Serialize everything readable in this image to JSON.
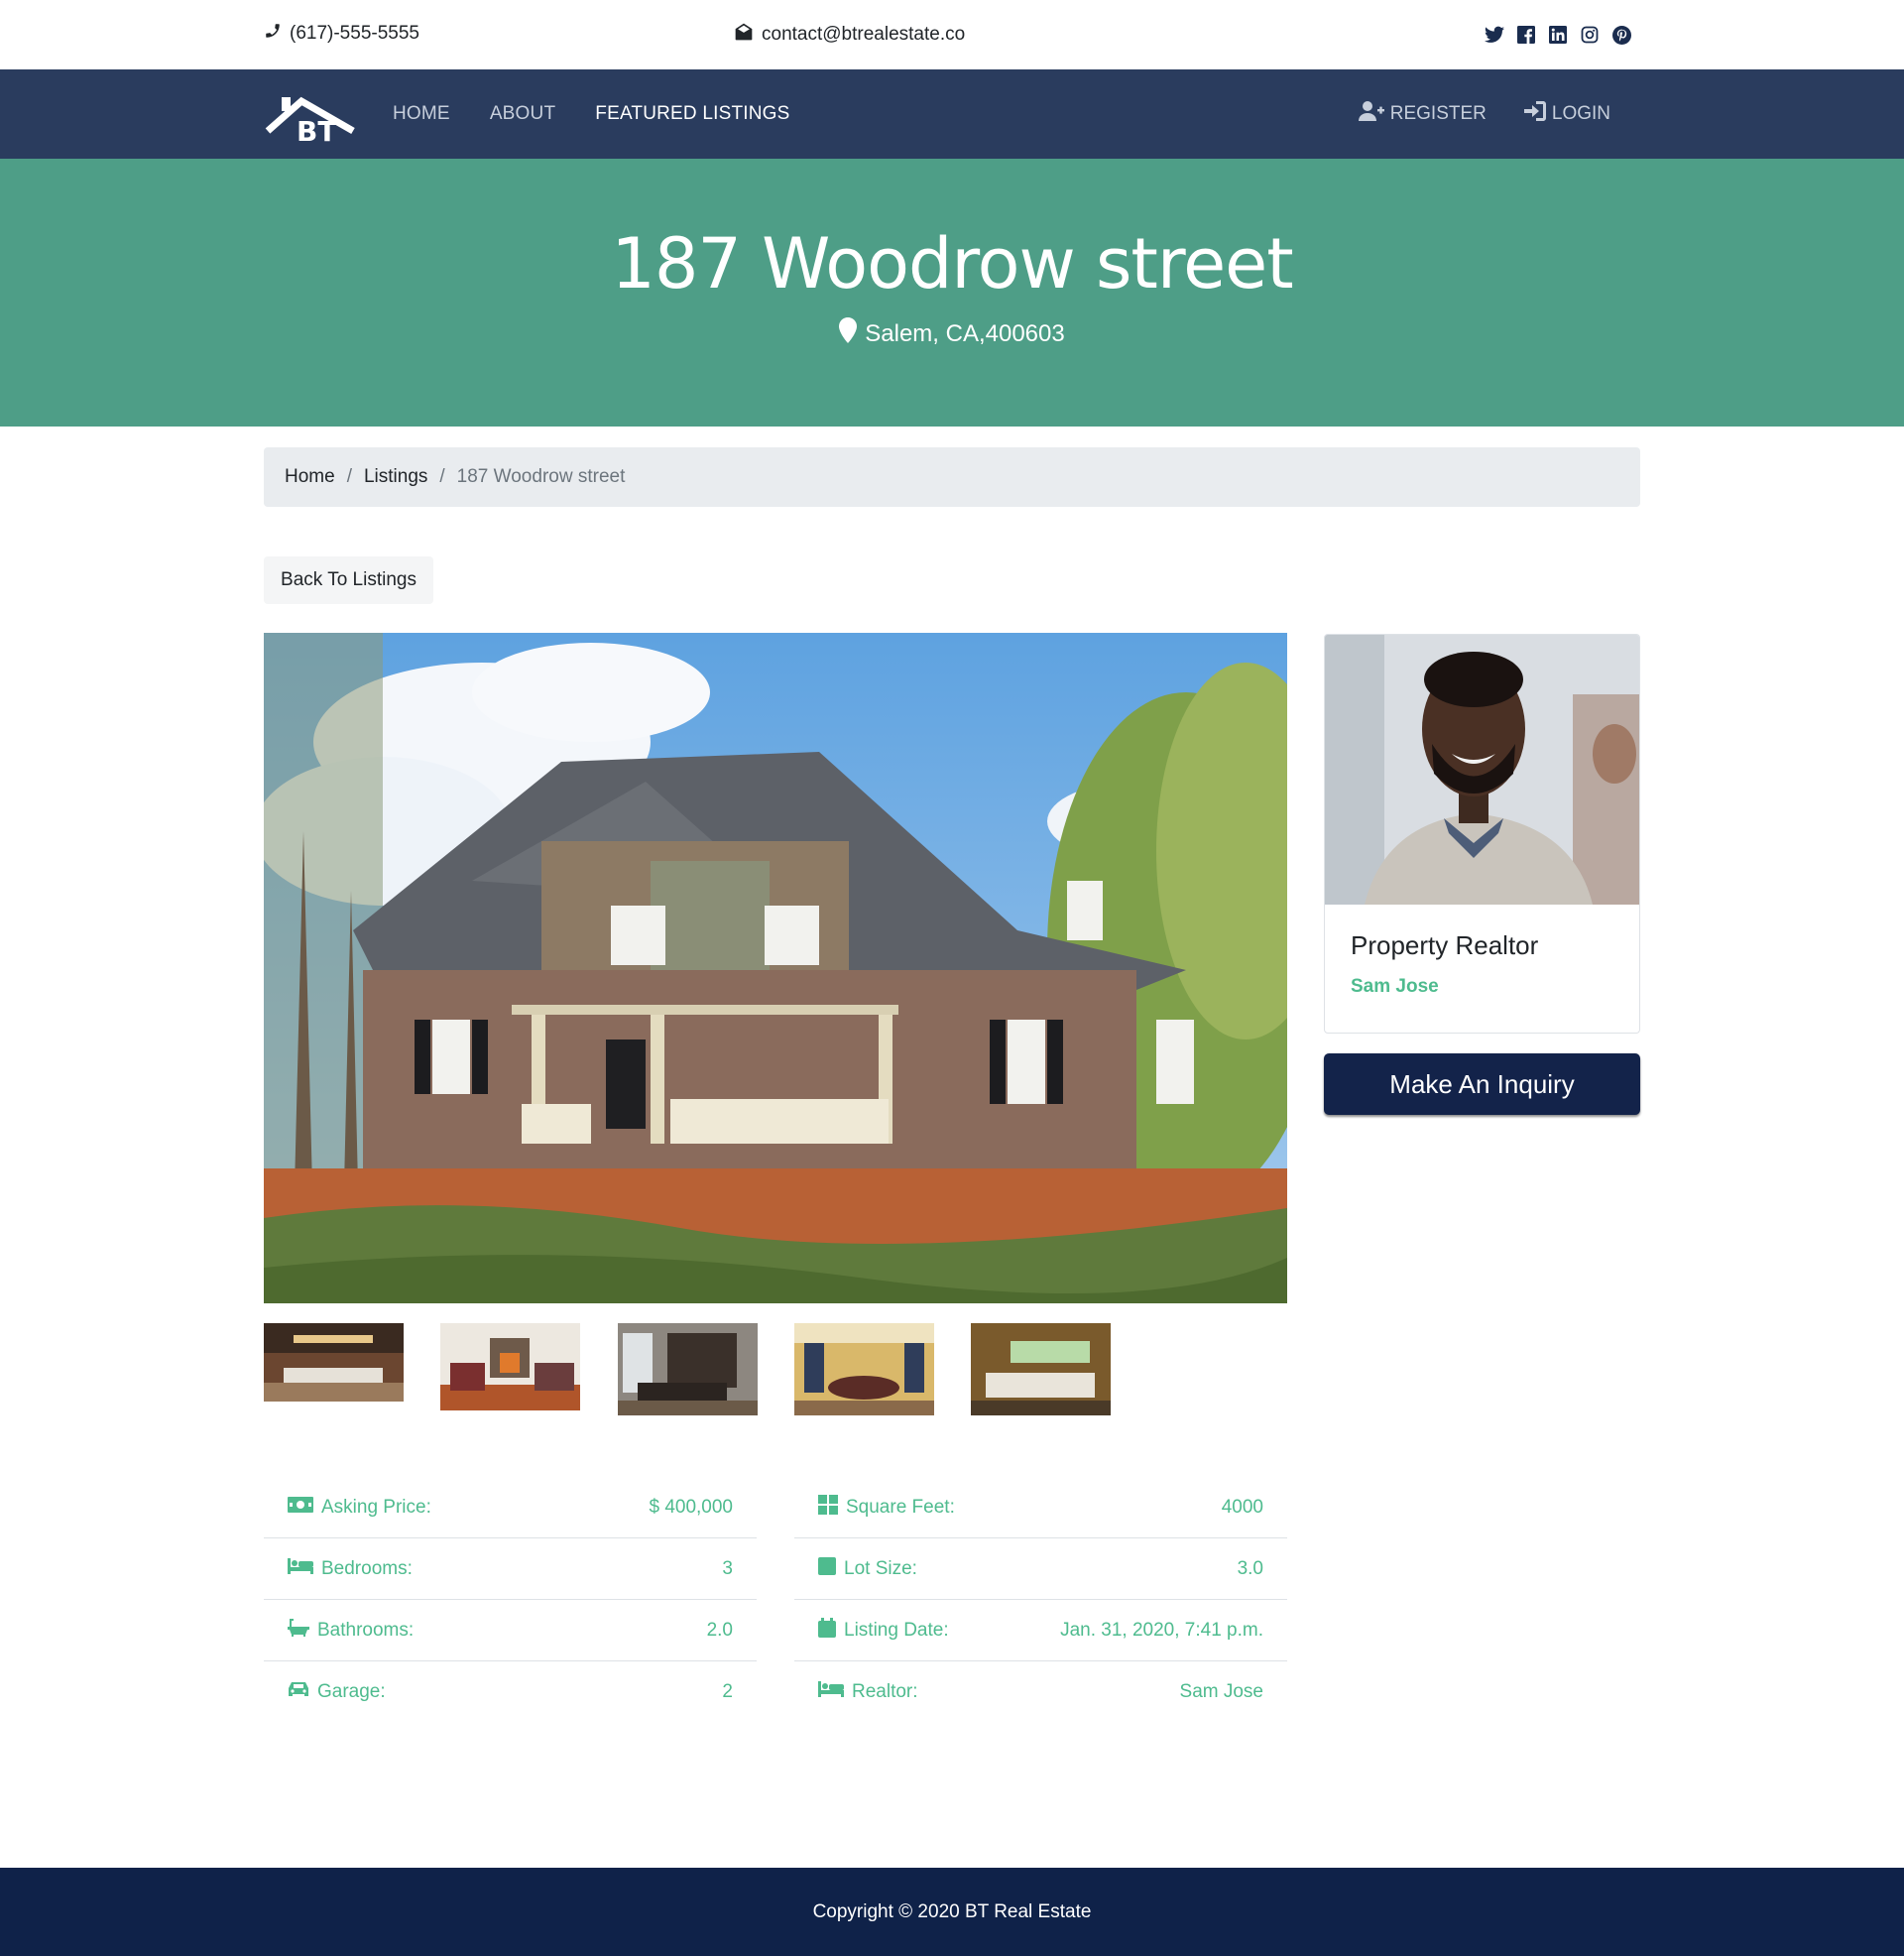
{
  "topbar": {
    "phone": "(617)-555-5555",
    "email": "contact@btrealestate.co",
    "social_icons": [
      "twitter-icon",
      "facebook-icon",
      "linkedin-icon",
      "instagram-icon",
      "pinterest-icon"
    ]
  },
  "navbar": {
    "logo_text": "BT",
    "links": [
      {
        "label": "HOME",
        "active": false
      },
      {
        "label": "ABOUT",
        "active": false
      },
      {
        "label": "FEATURED LISTINGS",
        "active": true
      }
    ],
    "register_label": "REGISTER",
    "login_label": "LOGIN"
  },
  "hero": {
    "title": "187 Woodrow street",
    "location": "Salem, CA,400603"
  },
  "breadcrumb": {
    "home": "Home",
    "listings": "Listings",
    "current": "187 Woodrow street"
  },
  "back_button": "Back To Listings",
  "realtor": {
    "title": "Property Realtor",
    "name": "Sam Jose"
  },
  "inquiry_button": "Make An Inquiry",
  "details": {
    "left": [
      {
        "label": "Asking Price:",
        "value": "$ 400,000",
        "icon": "money-icon"
      },
      {
        "label": "Bedrooms:",
        "value": "3",
        "icon": "bed-icon"
      },
      {
        "label": "Bathrooms:",
        "value": "2.0",
        "icon": "bath-icon"
      },
      {
        "label": "Garage:",
        "value": "2",
        "icon": "car-icon"
      }
    ],
    "right": [
      {
        "label": "Square Feet:",
        "value": "4000",
        "icon": "grid-icon"
      },
      {
        "label": "Lot Size:",
        "value": "3.0",
        "icon": "square-icon"
      },
      {
        "label": "Listing Date:",
        "value": "Jan. 31, 2020, 7:41 p.m.",
        "icon": "calendar-icon"
      },
      {
        "label": "Realtor:",
        "value": "Sam Jose",
        "icon": "bed-icon"
      }
    ]
  },
  "footer": {
    "copyright": "Copyright © 2020 BT Real Estate"
  },
  "colors": {
    "navbar": "#2a3c5e",
    "hero": "#4e9e87",
    "accent": "#4ebb8e",
    "footer": "#0f2249",
    "button": "#13234a"
  }
}
